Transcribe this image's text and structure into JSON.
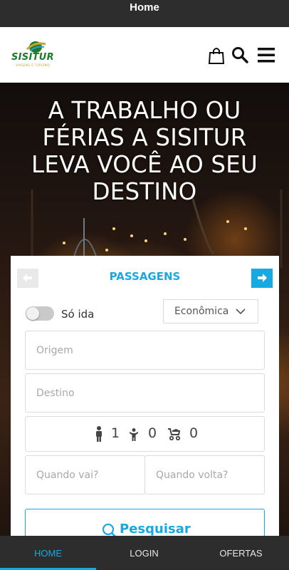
{
  "window": {
    "title": "Home"
  },
  "brand": {
    "name": "SISITUR",
    "tagline": "VIAGENS E TURISMO",
    "colors": {
      "green": "#1b7a2c",
      "gold": "#c8a52a",
      "blue": "#18a9e2"
    }
  },
  "header": {
    "icons": [
      "shopping-bag-icon",
      "search-icon",
      "menu-icon"
    ]
  },
  "hero": {
    "lines": [
      "A TRABALHO OU",
      "FÉRIAS A SISITUR",
      "LEVA VOCÊ AO SEU",
      "DESTINO"
    ]
  },
  "booking": {
    "tab_title": "PASSAGENS",
    "one_way_label": "Só ida",
    "one_way_enabled": false,
    "cabin_class": "Econômica",
    "origin_placeholder": "Origem",
    "destination_placeholder": "Destino",
    "passengers": {
      "adults": "1",
      "children": "0",
      "infants": "0"
    },
    "depart_placeholder": "Quando vai?",
    "return_placeholder": "Quando volta?",
    "search_label": "Pesquisar"
  },
  "bottom_nav": {
    "items": [
      {
        "label": "HOME",
        "active": true
      },
      {
        "label": "LOGIN",
        "active": false
      },
      {
        "label": "OFERTAS",
        "active": false
      }
    ]
  }
}
